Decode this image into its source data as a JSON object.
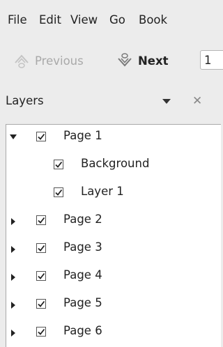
{
  "menubar": {
    "items": [
      "File",
      "Edit",
      "View",
      "Go",
      "Book"
    ]
  },
  "toolbar": {
    "previous_label": "Previous",
    "next_label": "Next",
    "page_value": "1"
  },
  "panel": {
    "title": "Layers"
  },
  "tree": {
    "rows": [
      {
        "label": "Page 1",
        "expander": "open",
        "checked": true,
        "level": 0
      },
      {
        "label": "Background",
        "expander": "none",
        "checked": true,
        "level": 1
      },
      {
        "label": "Layer 1",
        "expander": "none",
        "checked": true,
        "level": 1
      },
      {
        "label": "Page 2",
        "expander": "closed",
        "checked": true,
        "level": 0
      },
      {
        "label": "Page 3",
        "expander": "closed",
        "checked": true,
        "level": 0
      },
      {
        "label": "Page 4",
        "expander": "closed",
        "checked": true,
        "level": 0
      },
      {
        "label": "Page 5",
        "expander": "closed",
        "checked": true,
        "level": 0
      },
      {
        "label": "Page 6",
        "expander": "closed",
        "checked": true,
        "level": 0
      }
    ]
  }
}
